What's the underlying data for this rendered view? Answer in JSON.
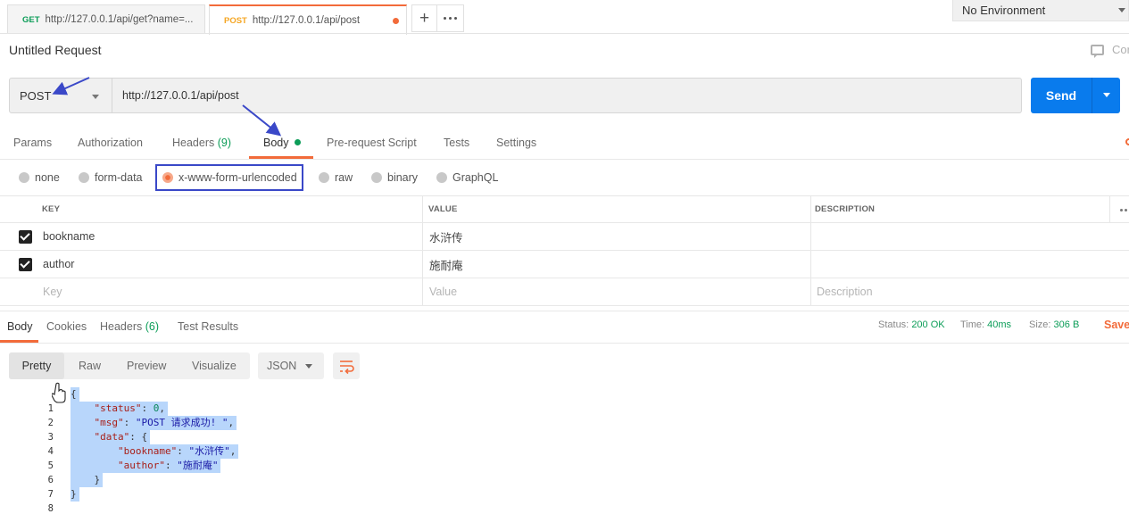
{
  "tabs": [
    {
      "method": "GET",
      "url": "http://127.0.0.1/api/get?name=..."
    },
    {
      "method": "POST",
      "url": "http://127.0.0.1/api/post"
    }
  ],
  "environment": "No Environment",
  "request": {
    "title": "Untitled Request",
    "comments_label": "Cor",
    "method": "POST",
    "url": "http://127.0.0.1/api/post",
    "send_label": "Send"
  },
  "sub_tabs": {
    "params": "Params",
    "authorization": "Authorization",
    "headers": "Headers",
    "headers_count": "(9)",
    "body": "Body",
    "pre_request": "Pre-request Script",
    "tests": "Tests",
    "settings": "Settings"
  },
  "body_types": [
    "none",
    "form-data",
    "x-www-form-urlencoded",
    "raw",
    "binary",
    "GraphQL"
  ],
  "params_table": {
    "headers": [
      "KEY",
      "VALUE",
      "DESCRIPTION"
    ],
    "rows": [
      {
        "key": "bookname",
        "value": "水浒传",
        "description": ""
      },
      {
        "key": "author",
        "value": "施耐庵",
        "description": ""
      }
    ],
    "placeholders": {
      "key": "Key",
      "value": "Value",
      "description": "Description"
    }
  },
  "response": {
    "tabs": {
      "body": "Body",
      "cookies": "Cookies",
      "headers": "Headers",
      "headers_count": "(6)",
      "test_results": "Test Results"
    },
    "status_label": "Status:",
    "status_value": "200 OK",
    "time_label": "Time:",
    "time_value": "40ms",
    "size_label": "Size:",
    "size_value": "306 B",
    "save_label": "Save",
    "views": [
      "Pretty",
      "Raw",
      "Preview",
      "Visualize"
    ],
    "format": "JSON",
    "code": {
      "l1": "{",
      "status_key": "\"status\"",
      "status_val": "0",
      "msg_key": "\"msg\"",
      "msg_val": "\"POST 请求成功! \"",
      "data_key": "\"data\"",
      "bookname_key": "\"bookname\"",
      "bookname_val": "\"水浒传\"",
      "author_key": "\"author\"",
      "author_val": "\"施耐庵\"",
      "l7": "}",
      "l8": "}"
    },
    "line_numbers": [
      "1",
      "2",
      "3",
      "4",
      "5",
      "6",
      "7",
      "8"
    ]
  },
  "colors": {
    "accent": "#f26b3a",
    "send": "#097bed",
    "green": "#0c9d58",
    "annotation": "#3a48c8",
    "selection": "#b8d6fb"
  }
}
